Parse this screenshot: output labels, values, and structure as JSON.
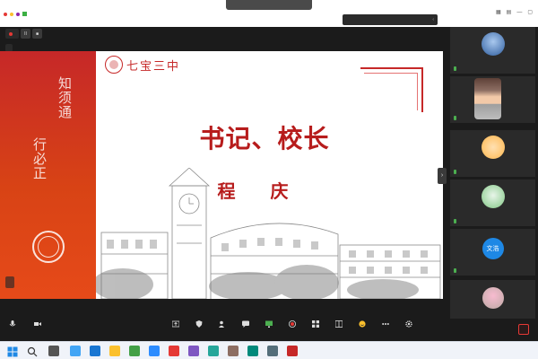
{
  "window": {
    "title": "",
    "speaker": "",
    "speaker_chevron": "‹"
  },
  "recording": {
    "label": "",
    "pause": "II",
    "stop": "■",
    "host": ""
  },
  "slide": {
    "school": "七宝三中",
    "motto_1": "知须通",
    "motto_2": "行必正",
    "headline": "书记、校长",
    "name": "程 庆",
    "presenter": ""
  },
  "sidebar": {
    "collapse": "›",
    "tiles": [
      {
        "label": ""
      },
      {
        "label": ""
      },
      {
        "label": ""
      },
      {
        "label": ""
      },
      {
        "label": "",
        "avatar_text": "文浩"
      },
      {
        "label": ""
      }
    ]
  },
  "toolbar": {
    "items": [
      {
        "label": "",
        "icon": "mic-icon"
      },
      {
        "label": "",
        "icon": "camera-icon"
      },
      {
        "label": "",
        "icon": "share-screen-icon"
      },
      {
        "label": "",
        "icon": "security-icon"
      },
      {
        "label": "",
        "icon": "participants-icon"
      },
      {
        "label": "",
        "icon": "chat-icon"
      },
      {
        "label": "",
        "icon": "screen-share-icon"
      },
      {
        "label": "",
        "icon": "record-icon"
      },
      {
        "label": "",
        "icon": "apps-icon"
      },
      {
        "label": "",
        "icon": "layout-icon"
      },
      {
        "label": "",
        "icon": "reactions-icon"
      },
      {
        "label": "",
        "icon": "more-icon"
      },
      {
        "label": "",
        "icon": "settings-icon"
      }
    ],
    "end_label": ""
  },
  "taskbar": {
    "time": "",
    "date": ""
  },
  "colors": {
    "slide_red": "#c62828",
    "slide_orange": "#e64a19",
    "end_red": "#e53935",
    "dark_bg": "#1b1b1b"
  }
}
